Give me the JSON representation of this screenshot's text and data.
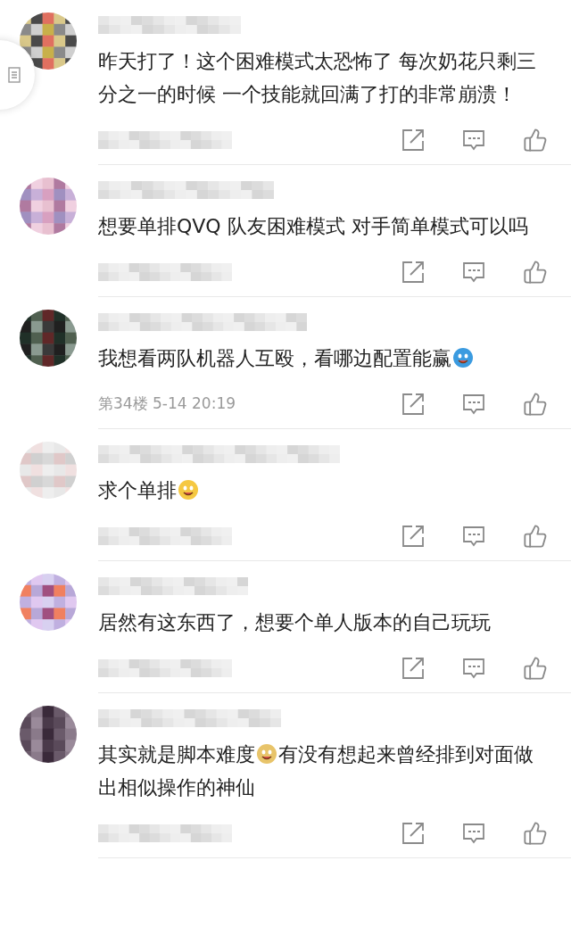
{
  "comments": [
    {
      "body": [
        {
          "kind": "text",
          "text": "昨天打了！这个困难模式太恐怖了 每次奶花只剩三分之一的时候 一个技能就回满了打的非常崩溃！"
        }
      ]
    },
    {
      "body": [
        {
          "kind": "text",
          "text": "想要单排QVQ 队友困难模式 对手简单模式可以吗"
        }
      ]
    },
    {
      "body": [
        {
          "kind": "text",
          "text": "我想看两队机器人互殴，看哪边配置能赢"
        },
        {
          "kind": "emoji",
          "color": "#3b9be0"
        }
      ],
      "meta": "第34楼 5-14 20:19"
    },
    {
      "body": [
        {
          "kind": "text",
          "text": "求个单排"
        },
        {
          "kind": "emoji",
          "color": "#f5c842"
        }
      ]
    },
    {
      "body": [
        {
          "kind": "text",
          "text": "居然有这东西了，想要个单人版本的自己玩玩"
        }
      ]
    },
    {
      "body": [
        {
          "kind": "text",
          "text": "其实就是脚本难度"
        },
        {
          "kind": "emoji",
          "color": "#e8c46a"
        },
        {
          "kind": "text",
          "text": "有没有想起来曾经排到对面做出相似操作的神仙"
        }
      ]
    }
  ]
}
